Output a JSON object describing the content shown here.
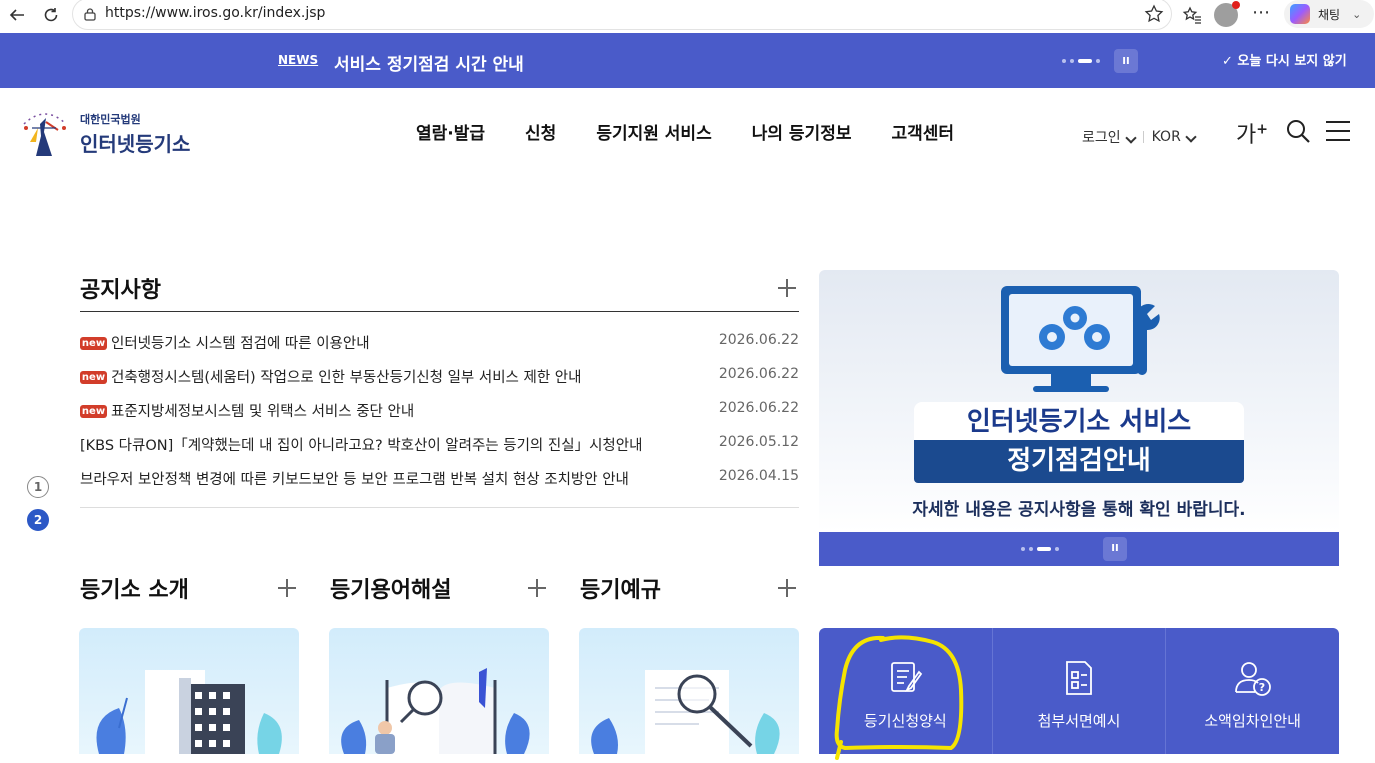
{
  "browser": {
    "url": "https://www.iros.go.kr/index.jsp",
    "copilot_label": "채팅"
  },
  "newsbar": {
    "tag": "NEWS",
    "title": "서비스 정기점검 시간 안내",
    "close_label": "오늘 다시 보지 않기",
    "pause_label": "II"
  },
  "header": {
    "logo_sub": "대한민국법원",
    "logo_main": "인터넷등기소",
    "gnb": [
      "열람·발급",
      "신청",
      "등기지원 서비스",
      "나의 등기정보",
      "고객센터"
    ],
    "login": "로그인",
    "lang": "KOR",
    "font_size": "가"
  },
  "notice": {
    "title": "공지사항",
    "new_badge": "new",
    "items": [
      {
        "text": "인터넷등기소 시스템 점검에 따른 이용안내",
        "date": "2026.06.22",
        "new": true
      },
      {
        "text": "건축행정시스템(세움터) 작업으로 인한 부동산등기신청 일부 서비스 제한 안내",
        "date": "2026.06.22",
        "new": true
      },
      {
        "text": "표준지방세정보시스템 및 위택스 서비스 중단 안내",
        "date": "2026.06.22",
        "new": true
      },
      {
        "text": "[KBS 다큐ON]「계약했는데 내 집이 아니라고요? 박호산이 알려주는 등기의 진실」시청안내",
        "date": "2026.05.12",
        "new": false
      },
      {
        "text": "브라우저 보안정책 변경에 따른 키보드보안 등 보안 프로그램 반복 설치 현상 조치방안 안내",
        "date": "2026.04.15",
        "new": false
      }
    ],
    "pages": [
      "1",
      "2"
    ],
    "active_page": "2"
  },
  "banner": {
    "line1": "인터넷등기소 서비스",
    "line2": "정기점검안내",
    "line3": "자세한 내용은 공지사항을 통해 확인 바랍니다.",
    "pause_label": "II"
  },
  "sections": {
    "intro": "등기소 소개",
    "terms": "등기용어해설",
    "rules": "등기예규"
  },
  "quick_links": [
    "등기신청양식",
    "첨부서면예시",
    "소액임차인안내"
  ],
  "colors": {
    "primary": "#4a5bc9",
    "new_badge": "#d23d2a",
    "banner_navy": "#1b4a8f",
    "highlight": "#f5e400"
  }
}
